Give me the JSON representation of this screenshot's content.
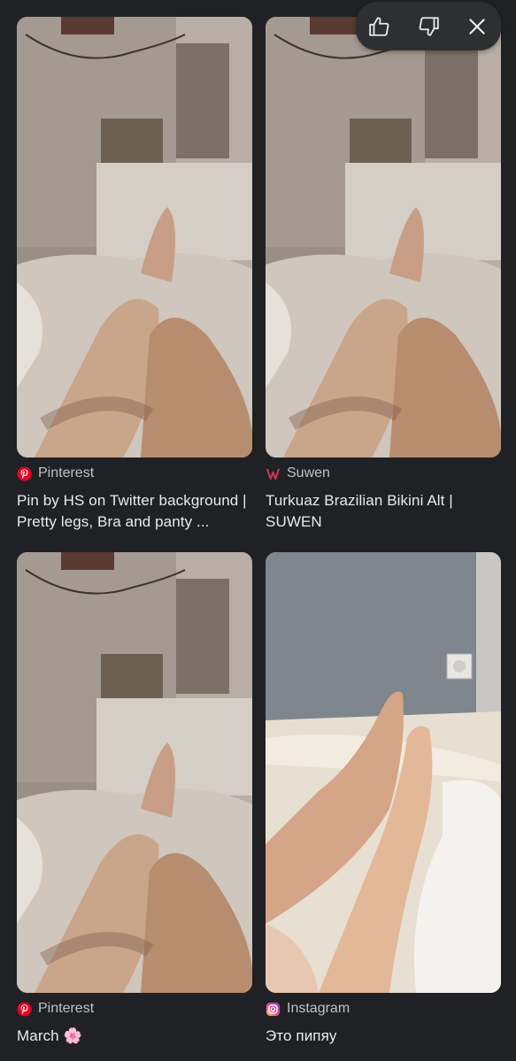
{
  "feedback": {
    "icons": [
      "thumbs-up-icon",
      "thumbs-down-icon",
      "close-icon"
    ]
  },
  "results": [
    {
      "source": "Pinterest",
      "source_icon": "pinterest-icon",
      "source_color": "#e60023",
      "title": "Pin by HS on Twitter background | Pretty legs, Bra and panty ..."
    },
    {
      "source": "Suwen",
      "source_icon": "suwen-icon",
      "source_color": "#c7345a",
      "title": "Turkuaz Brazilian Bikini Alt | SUWEN"
    },
    {
      "source": "Pinterest",
      "source_icon": "pinterest-icon",
      "source_color": "#e60023",
      "title": "March 🌸"
    },
    {
      "source": "Instagram",
      "source_icon": "instagram-icon",
      "source_color": "#d6249f",
      "title": "Это пипяу"
    }
  ]
}
